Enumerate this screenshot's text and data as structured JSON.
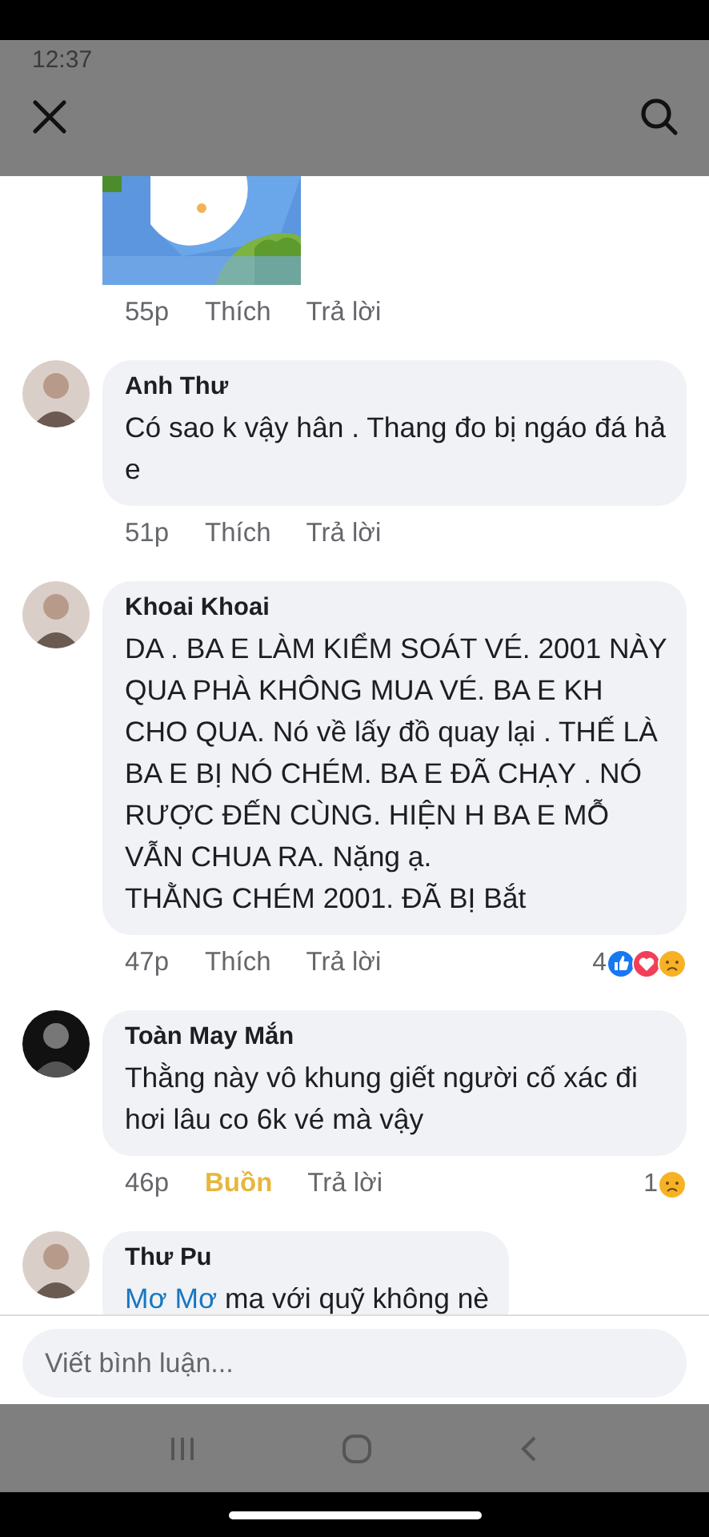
{
  "status_bar": {
    "time": "12:37"
  },
  "comments": [
    {
      "kind": "sticker",
      "time": "55p",
      "like_label": "Thích",
      "reacted": false,
      "reply_label": "Trả lời"
    },
    {
      "kind": "text",
      "author": "Anh Thư",
      "text": "Có sao k vậy hân . Thang đo bị ngáo đá hả e",
      "time": "51p",
      "like_label": "Thích",
      "reacted": false,
      "reply_label": "Trả lời"
    },
    {
      "kind": "text",
      "author": "Khoai Khoai",
      "text": "DA . BA E LÀM KIỂM SOÁT VÉ. 2001 NÀY QUA PHÀ KHÔNG MUA VÉ. BA E KH CHO QUA. Nó về lấy đồ quay lại . THẾ LÀ BA E BỊ NÓ CHÉM. BA E ĐÃ CHẠY . NÓ RƯỢC ĐẾN CÙNG. HIỆN H BA E MỖ VẪN CHUA RA. Nặng ạ.\nTHẰNG CHÉM 2001. ĐÃ BỊ Bắt",
      "time": "47p",
      "like_label": "Thích",
      "reacted": false,
      "reply_label": "Trả lời",
      "reactions": {
        "count": "4",
        "icons": [
          {
            "kind": "like"
          },
          {
            "kind": "love"
          },
          {
            "kind": "sad"
          }
        ]
      }
    },
    {
      "kind": "text",
      "author": "Toàn May Mắn",
      "text": "Thằng này vô khung giết người cố xác đi hơi lâu co 6k vé mà vậy",
      "time": "46p",
      "like_label": "Buồn",
      "reacted": true,
      "reply_label": "Trả lời",
      "reactions": {
        "count": "1",
        "icons": [
          {
            "kind": "sad"
          }
        ]
      }
    },
    {
      "kind": "mention",
      "author": "Thư Pu",
      "mention": "Mơ Mơ",
      "text": " ma với quỹ không nè"
    }
  ],
  "composer": {
    "placeholder": "Viết bình luận..."
  }
}
